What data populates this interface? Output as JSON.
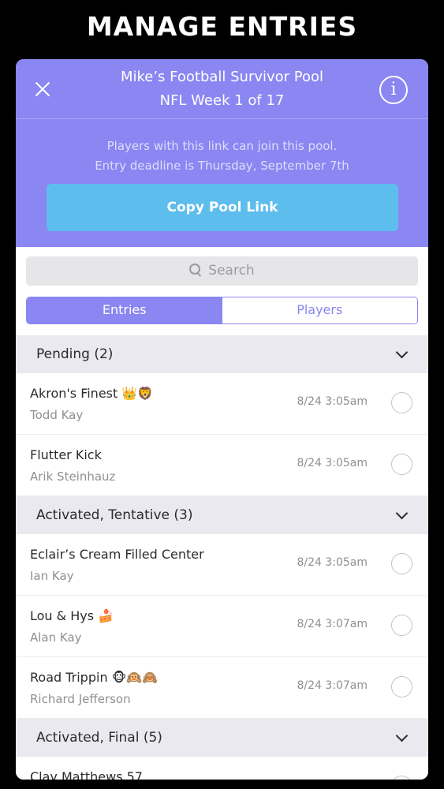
{
  "page": {
    "title": "MANAGE ENTRIES"
  },
  "header": {
    "pool_name": "Mike’s Football Survivor Pool",
    "week": "NFL Week 1 of 17",
    "join_line1": "Players with this link can join this pool.",
    "join_line2": "Entry deadline is Thursday, September 7th",
    "copy_button": "Copy Pool Link",
    "info_glyph": "i"
  },
  "search": {
    "placeholder": "Search"
  },
  "tabs": {
    "entries": "Entries",
    "players": "Players",
    "selected": "Entries"
  },
  "colors": {
    "accent": "#8a86f2",
    "copy_button": "#5dbdec",
    "section_bg": "#e9e9ef",
    "background": "#000000"
  },
  "icons": [
    "close-icon",
    "info-icon",
    "search-icon",
    "chevron-down-icon",
    "radio-unchecked-icon"
  ],
  "sections": [
    {
      "title": "Pending (2)",
      "rows": [
        {
          "entry": "Akron's Finest 👑🦁",
          "player": "Todd Kay",
          "time": "8/24 3:05am"
        },
        {
          "entry": "Flutter Kick",
          "player": "Arik Steinhauz",
          "time": "8/24 3:05am"
        }
      ]
    },
    {
      "title": "Activated, Tentative (3)",
      "rows": [
        {
          "entry": "Eclair’s Cream Filled Center",
          "player": "Ian Kay",
          "time": "8/24 3:05am"
        },
        {
          "entry": "Lou & Hys 🍰",
          "player": "Alan Kay",
          "time": "8/24 3:07am"
        },
        {
          "entry": "Road Trippin 🐵🙉🙈",
          "player": "Richard Jefferson",
          "time": "8/24 3:07am"
        }
      ]
    },
    {
      "title": "Activated, Final (5)",
      "rows": [
        {
          "entry": "Clay Matthews 57",
          "player": "",
          "time": ""
        }
      ]
    }
  ]
}
